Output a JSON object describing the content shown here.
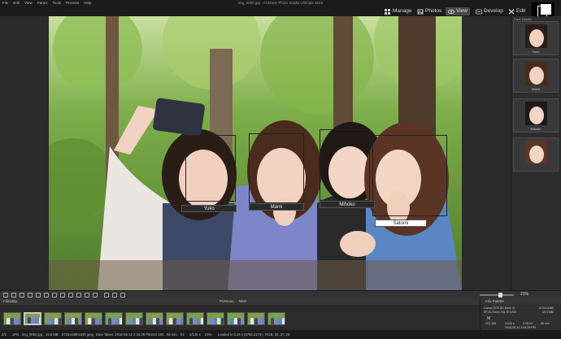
{
  "app": {
    "title": "img_0002.jpg - ACDSee Photo Studio Ultimate 2019"
  },
  "menu": [
    "File",
    "Edit",
    "View",
    "Panes",
    "Tools",
    "Process",
    "Help"
  ],
  "modes": [
    {
      "label": "Manage",
      "icon": "manage-icon"
    },
    {
      "label": "Photos",
      "icon": "photos-icon"
    },
    {
      "label": "View",
      "icon": "eye-icon",
      "active": true
    },
    {
      "label": "Develop",
      "icon": "develop-icon"
    },
    {
      "label": "Edit",
      "icon": "edit-icon"
    }
  ],
  "photo": {
    "faces": [
      {
        "name": "Yuko"
      },
      {
        "name": "Mami"
      },
      {
        "name": "Mihoko"
      },
      {
        "name": "Satomi",
        "editing": true
      }
    ]
  },
  "face_panel": {
    "header": "Face Details",
    "faces": [
      "Yuko",
      "Mami",
      "Mihoko",
      ""
    ]
  },
  "toolbar": {
    "zoom": "21%"
  },
  "filmstrip": {
    "title": "Filmstrip",
    "previous": "Previous",
    "next": "Next",
    "count": 14,
    "selected_index": 1
  },
  "info_palette": {
    "title": "Info Palette",
    "camera": "Canon EOS 5D Mark IV",
    "lens": "EF24-70mm f/4L IS USM",
    "iso": "ISO 400",
    "shutter": "1/125 s",
    "ev": "0.00 eV",
    "focal": "66 mm",
    "size": "6720x4480",
    "filesize": "19.5 MB",
    "date": "2018-05-12 2:44:29 PM"
  },
  "statusbar": {
    "index": "2/2",
    "type": "JPG",
    "filename": "img_0002.jpg",
    "filesize": "19.5 MB",
    "dimensions": "6720x4480x24b jpeg",
    "date_taken": "Date Taken: 2018-05-12 2:44:29 PM",
    "iso": "ISO 400",
    "focal": "66 mm",
    "aperture": "f/4",
    "shutter": "1/125 s",
    "zoom": "21%",
    "loaded": "Loaded in 0.26 s",
    "coords": "(3794,2174) - RGB: 32, 27, 25"
  },
  "colors": {
    "accent": "#4a4a4a",
    "foliage": "#6f9a3e"
  }
}
